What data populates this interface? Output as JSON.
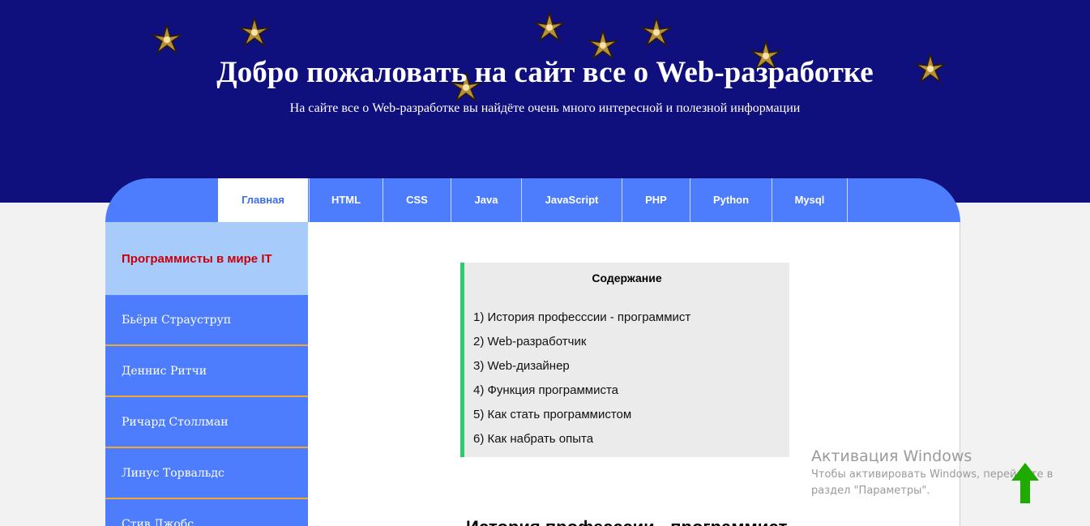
{
  "header": {
    "title": "Добро пожаловать на сайт все о Web-разработке",
    "subtitle": "На сайте все о Web-разработке вы найдёте очень много интересной и полезной информации",
    "background_color": "#0f0f7d",
    "decoration_icon": "gold-star-icon"
  },
  "nav": {
    "tabs": [
      {
        "label": "Главная",
        "active": true
      },
      {
        "label": "HTML"
      },
      {
        "label": "CSS"
      },
      {
        "label": "Java"
      },
      {
        "label": "JavaScript"
      },
      {
        "label": "PHP"
      },
      {
        "label": "Python"
      },
      {
        "label": "Mysql"
      }
    ],
    "color": "#4d7dfc"
  },
  "sidebar": {
    "heading": "Программисты в мире IT",
    "items": [
      "Бьёрн Страуструп",
      "Деннис Ритчи",
      "Ричард Столлман",
      "Линус Торвальдс",
      "Стив Джобс"
    ]
  },
  "toc": {
    "title": "Содержание",
    "items": [
      "1) История професссии - программист",
      "2) Web-разработчик",
      "3) Web-дизайнер",
      "4) Функция программиста",
      "5) Как стать программистом",
      "6) Как набрать опыта"
    ],
    "accent": "#2ecc71"
  },
  "main": {
    "section_heading": "История професссии - программист"
  },
  "watermark": {
    "title": "Активация Windows",
    "line1": "Чтобы активировать Windows, перейдите в",
    "line2": "раздел \"Параметры\"."
  },
  "scroll_top": {
    "icon": "arrow-up-icon",
    "color": "#1faa00"
  }
}
